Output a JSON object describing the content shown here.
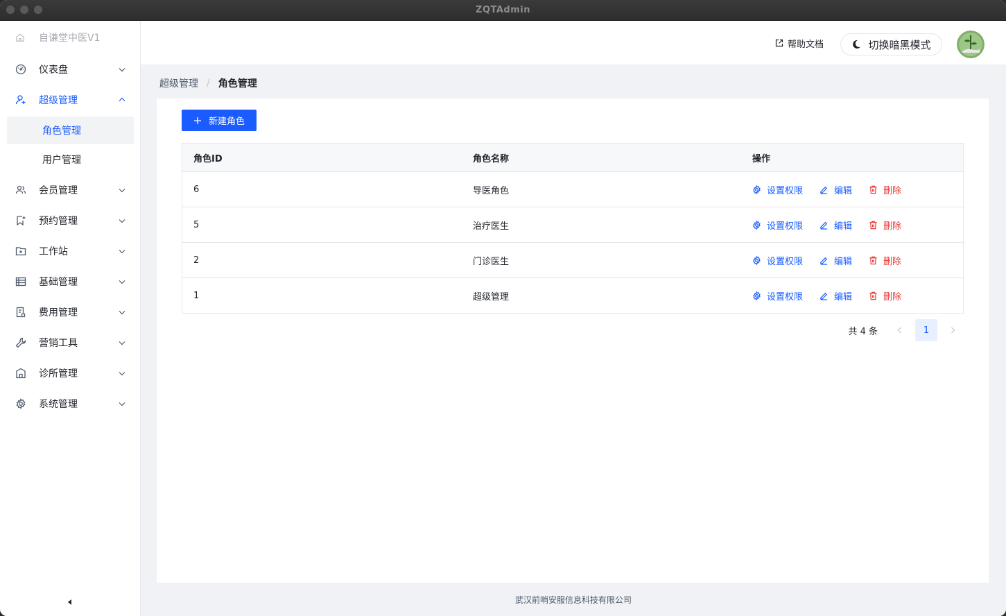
{
  "window": {
    "title": "ZQTAdmin"
  },
  "sidebar": {
    "brand": "自谦堂中医V1",
    "items": [
      {
        "label": "仪表盘",
        "icon": "dashboard-icon"
      },
      {
        "label": "超级管理",
        "icon": "user-admin-icon",
        "expanded": true,
        "children": [
          {
            "label": "角色管理",
            "active": true
          },
          {
            "label": "用户管理"
          }
        ]
      },
      {
        "label": "会员管理",
        "icon": "members-icon"
      },
      {
        "label": "预约管理",
        "icon": "bookmark-icon"
      },
      {
        "label": "工作站",
        "icon": "folder-add-icon"
      },
      {
        "label": "基础管理",
        "icon": "table-icon"
      },
      {
        "label": "费用管理",
        "icon": "receipt-icon"
      },
      {
        "label": "营销工具",
        "icon": "tool-icon"
      },
      {
        "label": "诊所管理",
        "icon": "building-icon"
      },
      {
        "label": "系统管理",
        "icon": "gear-icon"
      }
    ]
  },
  "header": {
    "help_label": "帮助文档",
    "dark_mode_label": "切换暗黑模式"
  },
  "breadcrumb": {
    "parent": "超级管理",
    "current": "角色管理"
  },
  "toolbar": {
    "new_role_label": "新建角色"
  },
  "table": {
    "columns": [
      "角色ID",
      "角色名称",
      "操作"
    ],
    "actions": {
      "permissions": "设置权限",
      "edit": "编辑",
      "delete": "删除"
    },
    "rows": [
      {
        "id": "6",
        "name": "导医角色"
      },
      {
        "id": "5",
        "name": "治疗医生"
      },
      {
        "id": "2",
        "name": "门诊医生"
      },
      {
        "id": "1",
        "name": "超级管理"
      }
    ]
  },
  "pagination": {
    "total_label": "共 4 条",
    "current_page": "1"
  },
  "footer": {
    "text": "武汉前哨安服信息科技有限公司"
  },
  "colors": {
    "primary": "#1a5cff",
    "danger": "#e53935",
    "background": "#f0f2f5"
  }
}
